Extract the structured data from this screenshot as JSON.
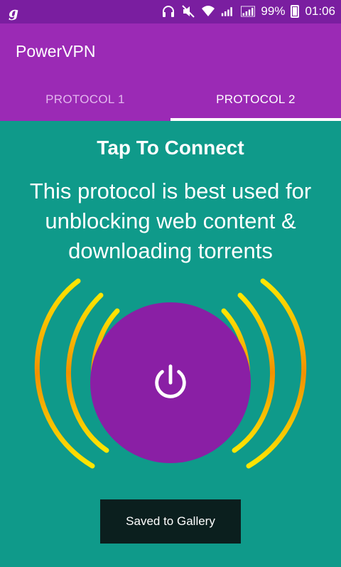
{
  "status_bar": {
    "app_glyph": "g",
    "battery_text": "99%",
    "time": "01:06",
    "icons": [
      "headset-icon",
      "mute-icon",
      "wifi-icon",
      "signal-4g-icon",
      "signal-2g-icon",
      "battery-icon"
    ]
  },
  "app_bar": {
    "title": "PowerVPN"
  },
  "tabs": [
    {
      "label": "PROTOCOL 1",
      "active": false
    },
    {
      "label": "PROTOCOL 2",
      "active": true
    }
  ],
  "main": {
    "headline": "Tap To Connect",
    "description": "This protocol is best used for unblocking web content & downloading torrents",
    "power_icon": "power-icon"
  },
  "toast": {
    "text": "Saved to Gallery"
  },
  "colors": {
    "status_bar": "#7a1ea0",
    "app_bar": "#9b2ab5",
    "background": "#0f9a8a",
    "power_button": "#8a1fa5",
    "arc_outer": "#f2a000",
    "arc_inner": "#ffe600",
    "toast": "#0b1f1e"
  }
}
